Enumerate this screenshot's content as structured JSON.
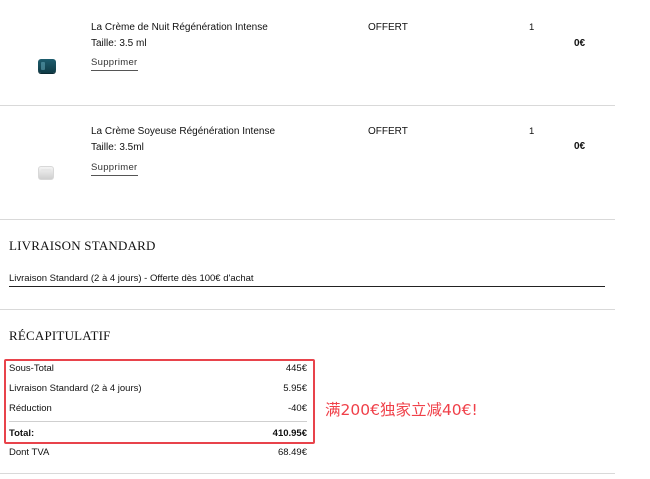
{
  "cart": {
    "items": [
      {
        "name": "La Crème de Nuit Régénération Intense",
        "size": "Taille: 3.5 ml",
        "remove_label": "Supprimer",
        "price": "OFFERT",
        "quantity": "1",
        "total": "0€",
        "icon": "dark-jar-icon"
      },
      {
        "name": "La Crème Soyeuse Régénération Intense",
        "size": "Taille: 3.5ml",
        "remove_label": "Supprimer",
        "price": "OFFERT",
        "quantity": "1",
        "total": "0€",
        "icon": "white-jar-icon"
      }
    ]
  },
  "shipping": {
    "title": "LIVRAISON STANDARD",
    "option": "Livraison Standard (2 à 4 jours) - Offerte dès 100€ d'achat"
  },
  "summary": {
    "title": "RÉCAPITULATIF",
    "rows": [
      {
        "label": "Sous-Total",
        "value": "445€"
      },
      {
        "label": "Livraison Standard (2 à 4 jours)",
        "value": "5.95€"
      },
      {
        "label": "Réduction",
        "value": "-40€"
      }
    ],
    "total": {
      "label": "Total:",
      "value": "410.95€"
    },
    "tax": {
      "label": "Dont TVA",
      "value": "68.49€"
    }
  },
  "annotation": {
    "promo_text": "满200€独家立减40€!",
    "color": "#f04049",
    "box_color": "#e8434b"
  }
}
